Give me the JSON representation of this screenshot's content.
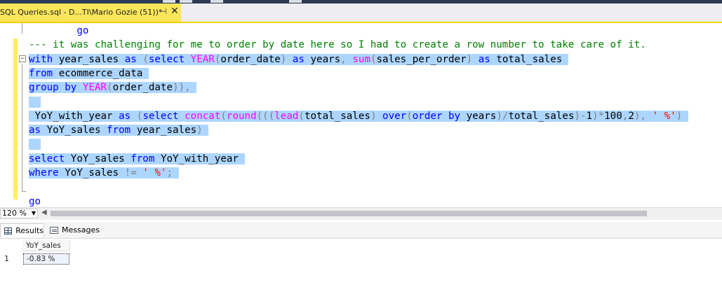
{
  "window": {
    "tab_title": "SQL Queries.sql - D...TI\\Mario Gozie (51))*",
    "pin_glyph": "⊣",
    "close_glyph": "✕"
  },
  "editor": {
    "lines": [
      {
        "indent": "        ",
        "tokens": [
          {
            "t": "go",
            "c": "kw"
          }
        ],
        "selected": false
      },
      {
        "indent": "",
        "tokens": [
          {
            "t": "--- it was challenging for me to order by date here so I had to create a row number to take care of it.",
            "c": "cm"
          }
        ],
        "selected": false
      },
      {
        "indent": "",
        "tokens": [
          {
            "t": "with ",
            "c": "kw"
          },
          {
            "t": "year_sales ",
            "c": ""
          },
          {
            "t": "as ",
            "c": "kw"
          },
          {
            "t": "(",
            "c": "gr"
          },
          {
            "t": "select ",
            "c": "kw"
          },
          {
            "t": "YEAR",
            "c": "fn"
          },
          {
            "t": "(",
            "c": "gr"
          },
          {
            "t": "order_date",
            "c": ""
          },
          {
            "t": ") ",
            "c": "gr"
          },
          {
            "t": "as ",
            "c": "kw"
          },
          {
            "t": "years",
            "c": ""
          },
          {
            "t": ", ",
            "c": "gr"
          },
          {
            "t": "sum",
            "c": "fn"
          },
          {
            "t": "(",
            "c": "gr"
          },
          {
            "t": "sales_per_order",
            "c": ""
          },
          {
            "t": ") ",
            "c": "gr"
          },
          {
            "t": "as ",
            "c": "kw"
          },
          {
            "t": "total_sales",
            "c": ""
          }
        ],
        "selected": true
      },
      {
        "indent": "",
        "tokens": [
          {
            "t": "from ",
            "c": "kw"
          },
          {
            "t": "ecommerce_data",
            "c": ""
          }
        ],
        "selected": true
      },
      {
        "indent": "",
        "tokens": [
          {
            "t": "group by ",
            "c": "kw"
          },
          {
            "t": "YEAR",
            "c": "fn"
          },
          {
            "t": "(",
            "c": "gr"
          },
          {
            "t": "order_date",
            "c": ""
          },
          {
            "t": ")),",
            "c": "gr"
          }
        ],
        "selected": true
      },
      {
        "indent": "",
        "tokens": [],
        "selected": true
      },
      {
        "indent": " ",
        "tokens": [
          {
            "t": "YoY_with_year ",
            "c": ""
          },
          {
            "t": "as ",
            "c": "kw"
          },
          {
            "t": "(",
            "c": "gr"
          },
          {
            "t": "select ",
            "c": "kw"
          },
          {
            "t": "concat",
            "c": "fn"
          },
          {
            "t": "(",
            "c": "gr"
          },
          {
            "t": "round",
            "c": "fn"
          },
          {
            "t": "(((",
            "c": "gr"
          },
          {
            "t": "lead",
            "c": "fn"
          },
          {
            "t": "(",
            "c": "gr"
          },
          {
            "t": "total_sales",
            "c": ""
          },
          {
            "t": ") ",
            "c": "gr"
          },
          {
            "t": "over",
            "c": "kw"
          },
          {
            "t": "(",
            "c": "gr"
          },
          {
            "t": "order by ",
            "c": "kw"
          },
          {
            "t": "years",
            "c": ""
          },
          {
            "t": ")/",
            "c": "gr"
          },
          {
            "t": "total_sales",
            "c": ""
          },
          {
            "t": ")-",
            "c": "gr"
          },
          {
            "t": "1",
            "c": ""
          },
          {
            "t": ")*",
            "c": "gr"
          },
          {
            "t": "100",
            "c": ""
          },
          {
            "t": ",",
            "c": "gr"
          },
          {
            "t": "2",
            "c": ""
          },
          {
            "t": "), ",
            "c": "gr"
          },
          {
            "t": "' %'",
            "c": "st"
          },
          {
            "t": ")",
            "c": "gr"
          }
        ],
        "selected": true
      },
      {
        "indent": "",
        "tokens": [
          {
            "t": "as ",
            "c": "kw"
          },
          {
            "t": "YoY_sales ",
            "c": ""
          },
          {
            "t": "from ",
            "c": "kw"
          },
          {
            "t": "year_sales",
            "c": ""
          },
          {
            "t": ")",
            "c": "gr"
          }
        ],
        "selected": true
      },
      {
        "indent": "",
        "tokens": [],
        "selected": true
      },
      {
        "indent": "",
        "tokens": [
          {
            "t": "select ",
            "c": "kw"
          },
          {
            "t": "YoY_sales ",
            "c": ""
          },
          {
            "t": "from ",
            "c": "kw"
          },
          {
            "t": "YoY_with_year",
            "c": ""
          }
        ],
        "selected": true
      },
      {
        "indent": "",
        "tokens": [
          {
            "t": "where ",
            "c": "kw"
          },
          {
            "t": "YoY_sales ",
            "c": ""
          },
          {
            "t": "!= ",
            "c": "gr"
          },
          {
            "t": "' %'",
            "c": "st"
          },
          {
            "t": ";",
            "c": "gr"
          }
        ],
        "selected": true
      },
      {
        "indent": "",
        "tokens": [],
        "selected": false
      },
      {
        "indent": "",
        "tokens": [
          {
            "t": "go",
            "c": "kw"
          }
        ],
        "selected": false
      }
    ]
  },
  "statusbar": {
    "zoom": "120 %",
    "zoom_dropdown_icon": "chevron-down-icon",
    "scroll_left_icon": "chevron-left-icon"
  },
  "results": {
    "tabs": [
      {
        "label": "Results",
        "icon": "grid-icon",
        "active": true
      },
      {
        "label": "Messages",
        "icon": "messages-icon",
        "active": false
      }
    ],
    "columns": [
      "YoY_sales"
    ],
    "rows": [
      {
        "num": "1",
        "cells": [
          "-0.83 %"
        ]
      }
    ]
  },
  "colors": {
    "selection": "#add6ff",
    "keyword": "#0000ff",
    "function": "#ff00ff",
    "comment": "#008000",
    "string": "#ff0000",
    "tab_active": "#fbe65a"
  }
}
